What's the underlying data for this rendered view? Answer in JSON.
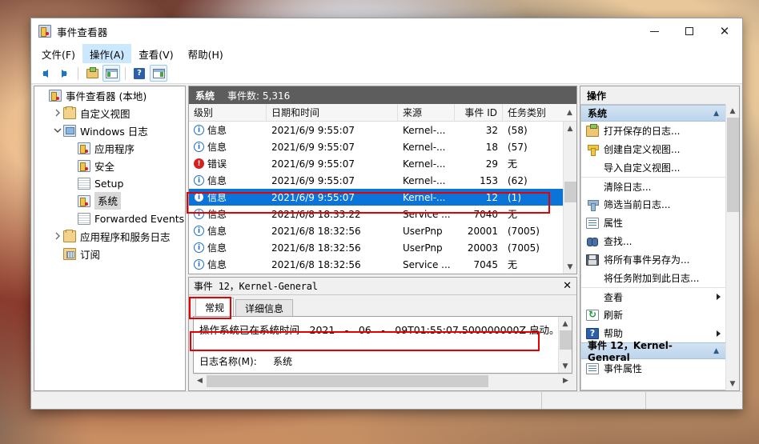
{
  "window": {
    "title": "事件查看器",
    "icon": "event-viewer-icon",
    "buttons": {
      "minimize": "–",
      "maximize": "□",
      "close": "✕"
    }
  },
  "menubar": [
    {
      "label": "文件(F)",
      "active": false
    },
    {
      "label": "操作(A)",
      "active": true
    },
    {
      "label": "查看(V)",
      "active": false
    },
    {
      "label": "帮助(H)",
      "active": false
    }
  ],
  "toolbar": [
    {
      "name": "back-arrow-icon",
      "framed": false
    },
    {
      "name": "forward-arrow-icon",
      "framed": false
    },
    {
      "name": "open-folder-icon",
      "framed": false
    },
    {
      "name": "show-tree-pane-icon",
      "framed": true
    },
    {
      "name": "help-icon",
      "framed": false
    },
    {
      "name": "show-action-pane-icon",
      "framed": true
    }
  ],
  "tree": [
    {
      "label": "事件查看器 (本地)",
      "indent": 0,
      "twisty": "none",
      "icon": "event-viewer",
      "selected": false
    },
    {
      "label": "自定义视图",
      "indent": 1,
      "twisty": "collapsed",
      "icon": "folder",
      "selected": false
    },
    {
      "label": "Windows 日志",
      "indent": 1,
      "twisty": "expanded",
      "icon": "windows-log",
      "selected": false
    },
    {
      "label": "应用程序",
      "indent": 2,
      "twisty": "none",
      "icon": "log-yellow",
      "selected": false
    },
    {
      "label": "安全",
      "indent": 2,
      "twisty": "none",
      "icon": "log-yellow",
      "selected": false
    },
    {
      "label": "Setup",
      "indent": 2,
      "twisty": "none",
      "icon": "log-plain",
      "selected": false
    },
    {
      "label": "系统",
      "indent": 2,
      "twisty": "none",
      "icon": "log-yellow",
      "selected": true
    },
    {
      "label": "Forwarded Events",
      "indent": 2,
      "twisty": "none",
      "icon": "log-plain",
      "selected": false
    },
    {
      "label": "应用程序和服务日志",
      "indent": 1,
      "twisty": "collapsed",
      "icon": "folder",
      "selected": false
    },
    {
      "label": "订阅",
      "indent": 1,
      "twisty": "none",
      "icon": "subscription",
      "selected": false
    }
  ],
  "list": {
    "pane_title": "系统",
    "count_label": "事件数: 5,316",
    "columns": [
      "级别",
      "日期和时间",
      "来源",
      "事件 ID",
      "任务类别"
    ],
    "rows": [
      {
        "level": "信息",
        "level_icon": "info-icon",
        "date": "2021/6/9 9:55:07",
        "source": "Kernel-...",
        "id": "32",
        "task": "(58)",
        "selected": false
      },
      {
        "level": "信息",
        "level_icon": "info-icon",
        "date": "2021/6/9 9:55:07",
        "source": "Kernel-...",
        "id": "18",
        "task": "(57)",
        "selected": false
      },
      {
        "level": "错误",
        "level_icon": "error-icon",
        "date": "2021/6/9 9:55:07",
        "source": "Kernel-...",
        "id": "29",
        "task": "无",
        "selected": false
      },
      {
        "level": "信息",
        "level_icon": "info-icon",
        "date": "2021/6/9 9:55:07",
        "source": "Kernel-...",
        "id": "153",
        "task": "(62)",
        "selected": false
      },
      {
        "level": "信息",
        "level_icon": "info-icon",
        "date": "2021/6/9 9:55:07",
        "source": "Kernel-...",
        "id": "12",
        "task": "(1)",
        "selected": true
      },
      {
        "level": "信息",
        "level_icon": "info-icon",
        "date": "2021/6/8 18:33:22",
        "source": "Service ...",
        "id": "7040",
        "task": "无",
        "selected": false
      },
      {
        "level": "信息",
        "level_icon": "info-icon",
        "date": "2021/6/8 18:32:56",
        "source": "UserPnp",
        "id": "20001",
        "task": "(7005)",
        "selected": false
      },
      {
        "level": "信息",
        "level_icon": "info-icon",
        "date": "2021/6/8 18:32:56",
        "source": "UserPnp",
        "id": "20003",
        "task": "(7005)",
        "selected": false
      },
      {
        "level": "信息",
        "level_icon": "info-icon",
        "date": "2021/6/8 18:32:56",
        "source": "Service ...",
        "id": "7045",
        "task": "无",
        "selected": false
      }
    ]
  },
  "detail": {
    "title": "事件 12，Kernel-General",
    "close_label": "✕",
    "tabs": [
      {
        "label": "常规",
        "active": true
      },
      {
        "label": "详细信息",
        "active": false
      }
    ],
    "message": "操作系统已在系统时间　2021　-　06　-　09T01:55:07.500000000Z 启动。",
    "log_name_key": "日志名称(M):",
    "log_name_value": "系统"
  },
  "actions": {
    "title": "操作",
    "groups": [
      {
        "label": "系统",
        "caret": "▲",
        "items": [
          {
            "label": "打开保存的日志...",
            "icon": "open-log-icon",
            "sep": false,
            "submenu": false
          },
          {
            "label": "创建自定义视图...",
            "icon": "filter-yellow-icon",
            "sep": false,
            "submenu": false
          },
          {
            "label": "导入自定义视图...",
            "icon": "none",
            "sep": false,
            "submenu": false
          },
          {
            "label": "清除日志...",
            "icon": "none",
            "sep": true,
            "submenu": false
          },
          {
            "label": "筛选当前日志...",
            "icon": "filter-blue-icon",
            "sep": false,
            "submenu": false
          },
          {
            "label": "属性",
            "icon": "properties-icon",
            "sep": false,
            "submenu": false
          },
          {
            "label": "查找...",
            "icon": "find-icon",
            "sep": false,
            "submenu": false
          },
          {
            "label": "将所有事件另存为...",
            "icon": "save-icon",
            "sep": false,
            "submenu": false
          },
          {
            "label": "将任务附加到此日志...",
            "icon": "none",
            "sep": false,
            "submenu": false
          },
          {
            "label": "查看",
            "icon": "none",
            "sep": true,
            "submenu": true
          },
          {
            "label": "刷新",
            "icon": "refresh-icon",
            "sep": false,
            "submenu": false
          },
          {
            "label": "帮助",
            "icon": "help-icon",
            "sep": false,
            "submenu": true
          }
        ]
      },
      {
        "label": "事件 12，Kernel-General",
        "caret": "▲",
        "items": [
          {
            "label": "事件属性",
            "icon": "properties-icon",
            "sep": false,
            "submenu": false
          }
        ]
      }
    ]
  },
  "highlight_color": "#e80000"
}
